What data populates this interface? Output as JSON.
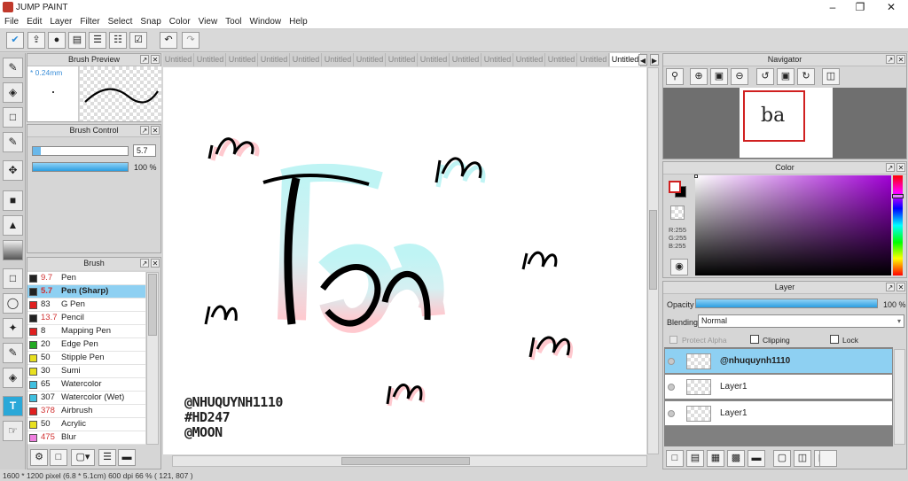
{
  "app": {
    "title": "JUMP PAINT"
  },
  "menu": [
    "File",
    "Edit",
    "Layer",
    "Filter",
    "Select",
    "Snap",
    "Color",
    "View",
    "Tool",
    "Window",
    "Help"
  ],
  "panels": {
    "brush_preview": {
      "title": "Brush Preview",
      "size_label": "* 0.24mm"
    },
    "brush_control": {
      "title": "Brush Control",
      "size_value": "5.7",
      "opacity_value": "100 %",
      "size_fill": 0.08,
      "opacity_fill": 1.0
    },
    "brush": {
      "title": "Brush",
      "items": [
        {
          "size": "9.7",
          "name": "Pen",
          "color": "#222222",
          "size_color": "#d03030"
        },
        {
          "size": "5.7",
          "name": "Pen (Sharp)",
          "color": "#222222",
          "size_color": "#d03030",
          "selected": true
        },
        {
          "size": "83",
          "name": "G Pen",
          "color": "#e02020",
          "size_color": "#222222"
        },
        {
          "size": "13.7",
          "name": "Pencil",
          "color": "#222222",
          "size_color": "#d03030"
        },
        {
          "size": "8",
          "name": "Mapping Pen",
          "color": "#e02020",
          "size_color": "#222222"
        },
        {
          "size": "20",
          "name": "Edge Pen",
          "color": "#22aa22",
          "size_color": "#222222"
        },
        {
          "size": "50",
          "name": "Stipple Pen",
          "color": "#e8e020",
          "size_color": "#222222"
        },
        {
          "size": "30",
          "name": "Sumi",
          "color": "#e8e020",
          "size_color": "#222222"
        },
        {
          "size": "65",
          "name": "Watercolor",
          "color": "#40c0e0",
          "size_color": "#222222"
        },
        {
          "size": "307",
          "name": "Watercolor (Wet)",
          "color": "#40c0e0",
          "size_color": "#222222"
        },
        {
          "size": "378",
          "name": "Airbrush",
          "color": "#e02020",
          "size_color": "#d03030"
        },
        {
          "size": "50",
          "name": "Acrylic",
          "color": "#e8e020",
          "size_color": "#222222"
        },
        {
          "size": "475",
          "name": "Blur",
          "color": "#f080e0",
          "size_color": "#d03030"
        }
      ]
    },
    "navigator": {
      "title": "Navigator"
    },
    "color": {
      "title": "Color",
      "r": "R:255",
      "g": "G:255",
      "b": "B:255"
    },
    "layer": {
      "title": "Layer",
      "opacity_label": "Opacity",
      "opacity_value": "100 %",
      "blending_label": "Blending",
      "blending_value": "Normal",
      "protect_alpha": "Protect Alpha",
      "clipping": "Clipping",
      "lock": "Lock",
      "layers": [
        {
          "name": "@nhuquynh1110",
          "selected": true
        },
        {
          "name": "Layer1"
        },
        {
          "name": "Layer1"
        }
      ]
    }
  },
  "tabs": {
    "inactive": "Untitled",
    "active": "Untitled",
    "count": 15
  },
  "canvas_text": [
    "@NHUQUYNH1110",
    "#HD247",
    "@MOON"
  ],
  "status": "1600 * 1200 pixel   (6.8 * 5.1cm)  600 dpi  66 %  ( 121, 807 )",
  "colors": {
    "accent": "#8ed0f2",
    "toolbar": "#d9d9d9",
    "canvas": "#ffffff"
  }
}
